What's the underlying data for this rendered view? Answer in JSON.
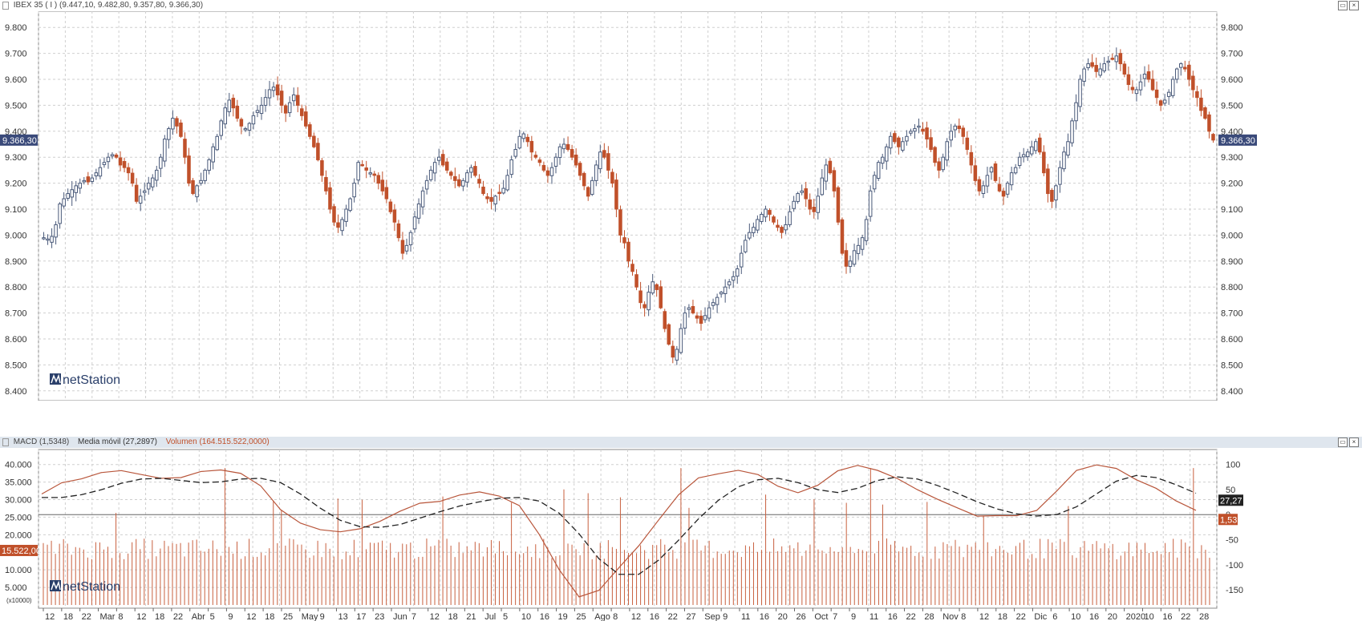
{
  "main_panel": {
    "title": "IBEX 35 ( I ) (9.447,10, 9.482,80, 9.357,80, 9.366,30)",
    "price_badge": "9.366,30",
    "logo_text": "netStation"
  },
  "indicator_panel": {
    "legend_macd": "MACD (1,5348)",
    "legend_ma": "Media móvil (27,2897)",
    "legend_volume": "Volumen (164.515.522,0000)",
    "badge_volume": "15.522,00",
    "badge_ma": "27,27",
    "badge_macd": "1,53",
    "volume_unit": "(x10000)",
    "logo_text": "netStation"
  },
  "colors": {
    "bearish": "#c0502a",
    "bullish_outline": "#4a5a7a",
    "grid": "#cfcfcf",
    "badge_bg": "#3a4a7a",
    "macd_line": "#b8553a",
    "ma_line": "#222222",
    "volume_bar": "#c8603f"
  },
  "chart_data": [
    {
      "type": "candlestick",
      "title": "IBEX 35 ( I )",
      "ylim": [
        8400,
        9800
      ],
      "y_ticks": [
        "9.800",
        "9.700",
        "9.600",
        "9.500",
        "9.400",
        "9.300",
        "9.200",
        "9.100",
        "9.000",
        "8.900",
        "8.800",
        "8.700",
        "8.600",
        "8.500",
        "8.400"
      ],
      "x_tick_labels": [
        "12",
        "18",
        "22",
        "Mar",
        "8",
        "12",
        "18",
        "22",
        "Abr",
        "5",
        "9",
        "12",
        "18",
        "25",
        "May",
        "9",
        "13",
        "17",
        "23",
        "Jun",
        "7",
        "12",
        "18",
        "21",
        "Jul",
        "5",
        "10",
        "16",
        "19",
        "25",
        "Ago",
        "8",
        "12",
        "16",
        "22",
        "27",
        "Sep",
        "9",
        "11",
        "16",
        "20",
        "26",
        "Oct",
        "7",
        "9",
        "11",
        "16",
        "22",
        "28",
        "Nov",
        "8",
        "12",
        "18",
        "22",
        "Dic",
        "6",
        "10",
        "16",
        "20",
        "2020",
        "10",
        "16",
        "22",
        "28"
      ],
      "close_series": [
        8990,
        8985,
        8995,
        9040,
        9120,
        9140,
        9160,
        9175,
        9190,
        9200,
        9210,
        9205,
        9220,
        9240,
        9260,
        9280,
        9300,
        9310,
        9300,
        9270,
        9260,
        9240,
        9200,
        9130,
        9150,
        9170,
        9200,
        9220,
        9250,
        9300,
        9370,
        9410,
        9450,
        9420,
        9380,
        9300,
        9200,
        9160,
        9190,
        9210,
        9250,
        9290,
        9340,
        9380,
        9440,
        9490,
        9520,
        9490,
        9450,
        9420,
        9410,
        9430,
        9460,
        9480,
        9500,
        9530,
        9560,
        9570,
        9540,
        9500,
        9470,
        9510,
        9540,
        9500,
        9460,
        9420,
        9380,
        9340,
        9290,
        9230,
        9170,
        9100,
        9050,
        9030,
        9060,
        9100,
        9140,
        9200,
        9280,
        9270,
        9250,
        9240,
        9230,
        9200,
        9170,
        9140,
        9090,
        9050,
        8990,
        8930,
        8960,
        9010,
        9070,
        9120,
        9170,
        9210,
        9250,
        9280,
        9300,
        9270,
        9250,
        9230,
        9210,
        9190,
        9210,
        9240,
        9260,
        9230,
        9200,
        9160,
        9140,
        9130,
        9150,
        9160,
        9180,
        9230,
        9290,
        9330,
        9380,
        9390,
        9360,
        9320,
        9300,
        9280,
        9250,
        9230,
        9260,
        9300,
        9340,
        9350,
        9330,
        9300,
        9270,
        9230,
        9190,
        9150,
        9210,
        9270,
        9320,
        9300,
        9250,
        9200,
        9100,
        9000,
        8970,
        8900,
        8860,
        8800,
        8740,
        8720,
        8780,
        8820,
        8790,
        8720,
        8640,
        8580,
        8530,
        8560,
        8640,
        8700,
        8720,
        8700,
        8680,
        8660,
        8690,
        8720,
        8740,
        8760,
        8780,
        8800,
        8820,
        8840,
        8870,
        8930,
        8980,
        9010,
        9030,
        9060,
        9080,
        9100,
        9080,
        9050,
        9030,
        9010,
        9040,
        9090,
        9130,
        9160,
        9170,
        9140,
        9100,
        9090,
        9150,
        9220,
        9270,
        9240,
        9170,
        9050,
        8930,
        8880,
        8900,
        8940,
        8960,
        8990,
        9060,
        9170,
        9230,
        9280,
        9300,
        9340,
        9380,
        9360,
        9340,
        9360,
        9380,
        9400,
        9410,
        9420,
        9400,
        9370,
        9330,
        9280,
        9250,
        9300,
        9360,
        9400,
        9420,
        9410,
        9380,
        9330,
        9270,
        9210,
        9170,
        9190,
        9230,
        9260,
        9210,
        9170,
        9150,
        9200,
        9240,
        9260,
        9300,
        9310,
        9320,
        9340,
        9360,
        9320,
        9240,
        9160,
        9130,
        9190,
        9260,
        9320,
        9360,
        9440,
        9510,
        9600,
        9640,
        9660,
        9650,
        9630,
        9640,
        9660,
        9670,
        9680,
        9690,
        9660,
        9620,
        9580,
        9560,
        9560,
        9590,
        9620,
        9600,
        9560,
        9530,
        9500,
        9520,
        9550,
        9600,
        9640,
        9660,
        9640,
        9600,
        9560,
        9530,
        9480,
        9450,
        9400,
        9366
      ],
      "badge_value": "9.366,30"
    },
    {
      "type": "line+bar",
      "series": [
        {
          "name": "MACD (1,5348)",
          "ylim": [
            -180,
            120
          ],
          "y_ticks": [
            100,
            50,
            0,
            -50,
            -100,
            -150
          ],
          "last_value": "1,53"
        },
        {
          "name": "Media móvil (27,2897)",
          "last_value": "27,27"
        },
        {
          "name": "Volumen (164.515.522,0000)",
          "ylim": [
            0,
            460000
          ],
          "y_ticks": [
            "40.000",
            "35.000",
            "30.000",
            "25.000",
            "20.000",
            "15.000",
            "10.000",
            "5.000"
          ],
          "last_value": "15.522,00",
          "unit": "(x10000)"
        }
      ]
    }
  ]
}
